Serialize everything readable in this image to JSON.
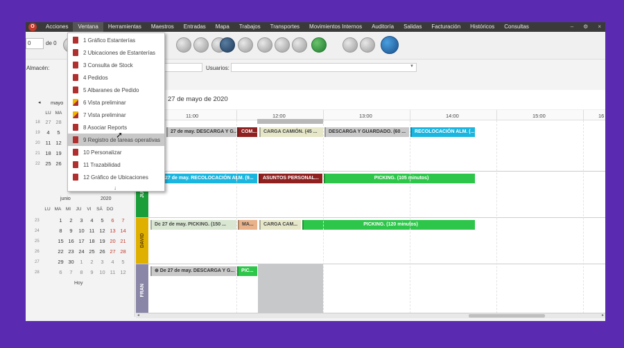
{
  "menubar": {
    "logo": "O",
    "items": [
      "Acciones",
      "Ventana",
      "Herramientas",
      "Maestros",
      "Entradas",
      "Mapa",
      "Trabajos",
      "Transportes",
      "Movimientos Internos",
      "Auditoría",
      "Salidas",
      "Facturación",
      "Históricos",
      "Consultas"
    ],
    "window_controls": [
      "–",
      "⚙",
      "×"
    ]
  },
  "toolbar": {
    "page_value": "0",
    "page_of": "de 0"
  },
  "filters": {
    "almacen_label": "Almacén:",
    "usuarios_label": "Usuarios:",
    "usuarios_value": ""
  },
  "ventana_menu": {
    "items": [
      {
        "label": "1 Gráfico Estanterías",
        "icon": "app-icon"
      },
      {
        "label": "2 Ubicaciones de Estanterías",
        "icon": "app-icon"
      },
      {
        "label": "3 Consulta de Stock",
        "icon": "app-icon"
      },
      {
        "label": "4 Pedidos",
        "icon": "app-icon"
      },
      {
        "label": "5 Albaranes de Pedido",
        "icon": "app-icon"
      },
      {
        "label": "6 Vista preliminar",
        "icon": "preview-icon"
      },
      {
        "label": "7 Vista preliminar",
        "icon": "preview-icon"
      },
      {
        "label": "8 Asociar Reports",
        "icon": "app-icon"
      },
      {
        "label": "9 Registro de tareas operativas",
        "icon": "app-icon"
      },
      {
        "label": "10 Personalizar",
        "icon": "app-icon"
      },
      {
        "label": "11 Trazabilidad",
        "icon": "app-icon"
      },
      {
        "label": "12 Gráfico de Ubicaciones",
        "icon": "app-icon"
      }
    ],
    "highlighted_index": 8,
    "more_arrow": "↓"
  },
  "calendar_may": {
    "month": "mayo",
    "days_header": [
      "LU",
      "MA"
    ],
    "weeks": [
      {
        "wk": "18",
        "days": [
          "27",
          "28"
        ]
      },
      {
        "wk": "19",
        "days": [
          "4",
          "5"
        ]
      },
      {
        "wk": "20",
        "days": [
          "11",
          "12"
        ]
      },
      {
        "wk": "21",
        "days": [
          "18",
          "19"
        ]
      },
      {
        "wk": "22",
        "days": [
          "25",
          "26"
        ]
      }
    ]
  },
  "calendar_june": {
    "month": "junio",
    "year": "2020",
    "days_header": [
      "LU",
      "MA",
      "MI",
      "JU",
      "VI",
      "SÁ",
      "DO"
    ],
    "weeks": [
      {
        "wk": "23",
        "days": [
          "1",
          "2",
          "3",
          "4",
          "5",
          "6",
          "7"
        ]
      },
      {
        "wk": "24",
        "days": [
          "8",
          "9",
          "10",
          "11",
          "12",
          "13",
          "14"
        ]
      },
      {
        "wk": "25",
        "days": [
          "15",
          "16",
          "17",
          "18",
          "19",
          "20",
          "21"
        ]
      },
      {
        "wk": "26",
        "days": [
          "22",
          "23",
          "24",
          "25",
          "26",
          "27",
          "28"
        ]
      },
      {
        "wk": "27",
        "days": [
          "29",
          "30",
          "1",
          "2",
          "3",
          "4",
          "5"
        ]
      },
      {
        "wk": "28",
        "days": [
          "6",
          "7",
          "8",
          "9",
          "10",
          "11",
          "12"
        ]
      }
    ],
    "today_label": "Hoy"
  },
  "scheduler": {
    "date_title": "27 de mayo de 2020",
    "hours": [
      "11:00",
      "12:00",
      "13:00",
      "14:00",
      "15:00",
      "16"
    ],
    "lanes": [
      {
        "name": "",
        "color": "#1a9e3a",
        "events": [
          {
            "label": "27 de may. DESCARGA Y G...",
            "style": "grey"
          },
          {
            "label": "COM...",
            "style": "maroon"
          },
          {
            "label": "CARGA CAMIÓN. (45 ...",
            "style": "beige"
          },
          {
            "label": "DESCARGA Y GUARDADO. (60 ...",
            "style": "grey"
          },
          {
            "label": "RECOLOCACIÓN ALM. (...",
            "style": "cyan"
          }
        ]
      },
      {
        "name": "JU",
        "color": "#1a9e3a",
        "events": [
          {
            "label": "27 de may. RECOLOCACIÓN ALM. (9...",
            "style": "cyan"
          },
          {
            "label": "ASUNTOS PERSONAL...",
            "style": "maroon"
          },
          {
            "label": "PICKING. (105 minutos)",
            "style": "green"
          }
        ]
      },
      {
        "name": "DAVID",
        "color": "#e0b000",
        "events": [
          {
            "label": "Dc 27 de may. PICKING. (150 ...",
            "style": "lg"
          },
          {
            "label": "MA...",
            "style": "salmon"
          },
          {
            "label": "CARGA CAM...",
            "style": "beige"
          },
          {
            "label": "PICKING. (120 minutos)",
            "style": "green"
          }
        ]
      },
      {
        "name": "FRAN",
        "color": "#8a86a8",
        "events": [
          {
            "label": "⊕ De 27 de may. DESCARGA Y G...",
            "style": "grey"
          },
          {
            "label": "PIC...",
            "style": "green"
          }
        ]
      }
    ]
  }
}
